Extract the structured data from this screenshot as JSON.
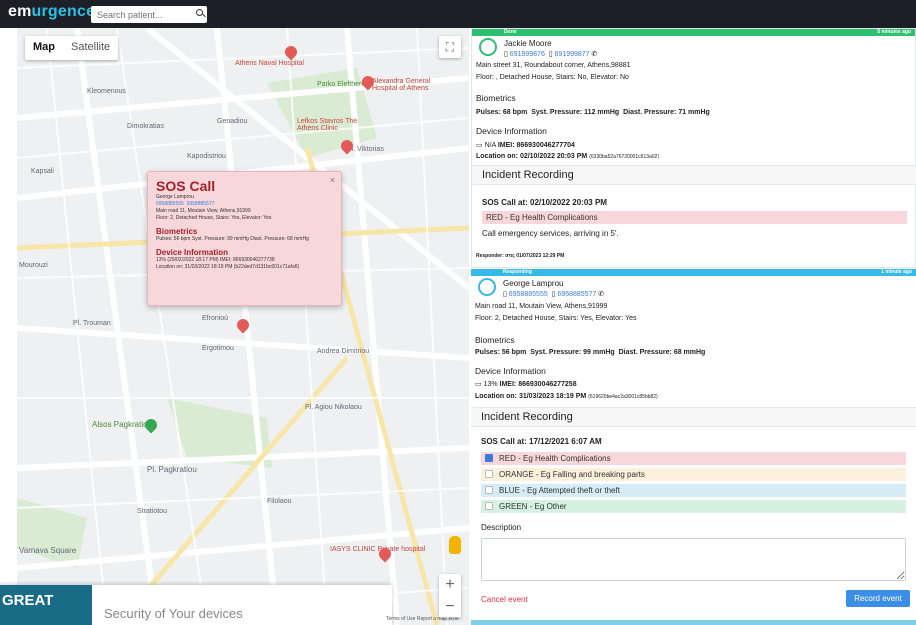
{
  "header": {
    "logo_a": "em",
    "logo_b": "urgence",
    "search_placeholder": "Search patient..."
  },
  "map": {
    "type_map": "Map",
    "type_satellite": "Satellite",
    "labels": [
      "Athens Naval Hospital",
      "Alexandra General Hospital of Athens",
      "Lefkos Stavros The Athens Clinic",
      "Parko Eleftherias",
      "Pl. Viktorias",
      "Andrea Dimitriou",
      "Alsos Pagkratiou",
      "Pl. Pagkratiou",
      "Varnava Square",
      "IASYS CLINIC Private hospital",
      "Ergotimou",
      "Efronioú",
      "Pl. Trouman",
      "Kapsali",
      "Mourouzi",
      "Pl. Agiou Nikolaou",
      "Filolaou",
      "Stratiotou",
      "Dimokratias",
      "Kleomenous",
      "Genadiou",
      "Kapodistriou"
    ],
    "zoom_in": "+",
    "zoom_out": "−",
    "fullscreen": "⛶",
    "terms": "Terms of Use   Report a map error"
  },
  "popup": {
    "title": "SOS Call",
    "close": "×",
    "name": "George Lamprou",
    "phone1": "6958885555",
    "phone2": "6958885577",
    "address": "Main road 11, Moutain View, Athens,91999",
    "details": "Floor: 2, Detached House, Stairs: Yes, Elevator: Yes",
    "bio_title": "Biometrics",
    "bio": "Pulses: 56 bpm  Syst. Pressure: 99 mmHg  Diast. Pressure: 68 mmHg",
    "dev_title": "Device Information",
    "dev": "13% (25/02/2022 18:17 PM)  IMEI: 866930046277738",
    "loc": "Location on: 31/03/2023 18:19 PM (b22ded7d131bc601c71afa6)"
  },
  "footer": {
    "great": "GREAT",
    "text": "Security of Your devices"
  },
  "card1": {
    "status": "Done",
    "ago": "5 minutes ago",
    "color": "#2fbf71",
    "name": "Jackie Moore",
    "phone1": "691999876",
    "phone2": "691999877",
    "address": "Main street 31, Roundabout corner, Athens,98881",
    "floor": "Floor: , Detached House, Stairs: No, Elevator: No",
    "bio_title": "Biometrics",
    "pulses": "Pulses: 68 bpm",
    "syst": "Syst. Pressure: 112 mmHg",
    "diast": "Diast. Pressure: 71 mmHg",
    "dev_title": "Device Information",
    "battery": "N/A",
    "imei": "IMEI: 866930046277704",
    "loc": "Location on: 02/10/2022 20:03 PM",
    "loc_id": "(6330ba52a76720001c613a02)",
    "ir": "Incident Recording",
    "sos": "SOS Call at: 02/10/2022 20:03 PM",
    "tag": "RED - Eg Health Complications",
    "note": "Call emergency services, arriving in 5'.",
    "responder": "Responder: στις 01/07/2023 12:29 PM"
  },
  "card2": {
    "status": "Responding",
    "ago": "1 minute ago",
    "color": "#36b9e6",
    "name": "George Lamprou",
    "phone1": "6958885555",
    "phone2": "6958885577",
    "address": "Main road 11, Moutain View, Athens,91999",
    "floor": "Floor: 2, Detached House, Stairs: Yes, Elevator: Yes",
    "bio_title": "Biometrics",
    "pulses": "Pulses: 56 bpm",
    "syst": "Syst. Pressure: 99 mmHg",
    "diast": "Diast. Pressure: 68 mmHg",
    "dev_title": "Device Information",
    "battery": "13%",
    "imei": "IMEI: 866930046277258",
    "loc": "Location on: 31/03/2023 18:19 PM",
    "loc_id": "(619620be4ac2a3001c85bb82)",
    "ir": "Incident Recording",
    "sos": "SOS Call at: 17/12/2021 6:07 AM",
    "options": [
      {
        "label": "RED - Eg Health Complications",
        "color": "#f8d7da",
        "checked": true
      },
      {
        "label": "ORANGE - Eg Falling and breaking parts",
        "color": "#fdf0dc",
        "checked": false
      },
      {
        "label": "BLUE - Eg Attempted theft or theft",
        "color": "#d6ecf7",
        "checked": false
      },
      {
        "label": "GREEN - Eg Other",
        "color": "#d4f1e2",
        "checked": false
      }
    ],
    "desc_label": "Description",
    "cancel": "Cancel event",
    "record": "Record event"
  }
}
